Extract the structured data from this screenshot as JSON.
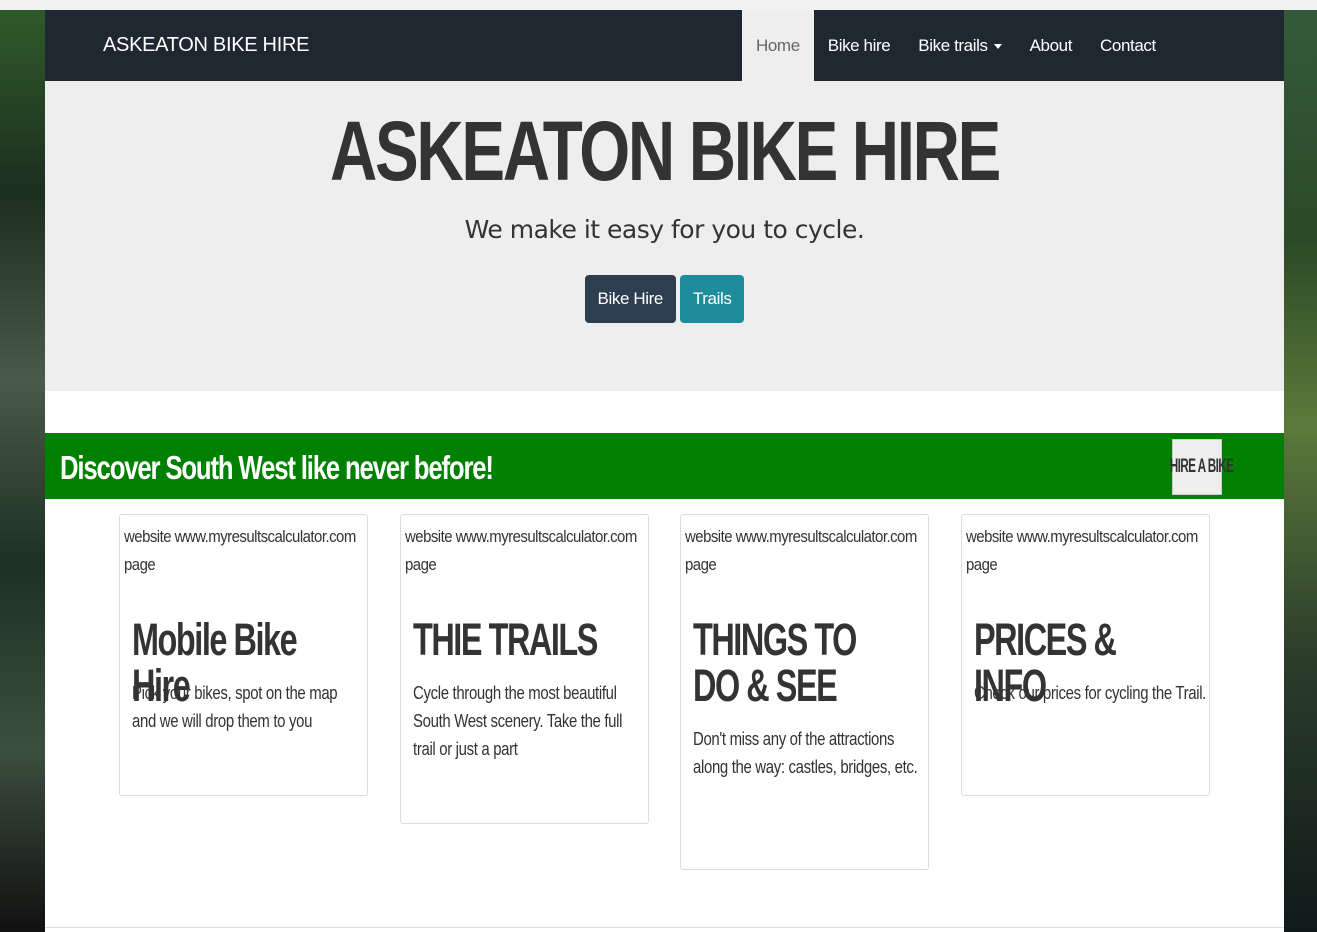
{
  "navbar": {
    "brand": "ASKEATON BIKE HIRE",
    "items": [
      {
        "label": "Home"
      },
      {
        "label": "Bike hire"
      },
      {
        "label": "Bike trails"
      },
      {
        "label": "About"
      },
      {
        "label": "Contact"
      }
    ]
  },
  "hero": {
    "title": "ASKEATON BIKE HIRE",
    "subtitle": "We make it easy for you to cycle.",
    "buttons": [
      {
        "label": "Bike Hire"
      },
      {
        "label": "Trails"
      }
    ]
  },
  "banner": {
    "text": "Discover South West like never before!",
    "button": "HIRE A BIKE"
  },
  "cards": [
    {
      "image_alt_line1": "website www.myresultscalculator.com",
      "image_alt_line2": "page",
      "title": "Mobile Bike Hire",
      "description": "Pick your bikes, spot on the map and we will drop them to you"
    },
    {
      "image_alt_line1": "website www.myresultscalculator.com",
      "image_alt_line2": "page",
      "title": "THIE TRAILS",
      "description": "Cycle through the most beautiful South West scenery. Take the full trail or just a part"
    },
    {
      "image_alt_line1": "website www.myresultscalculator.com",
      "image_alt_line2": "page",
      "title": "THINGS TO DO & SEE",
      "description": "Don't miss any of the attractions along the way: castles, bridges, etc."
    },
    {
      "image_alt_line1": "website www.myresultscalculator.com",
      "image_alt_line2": "page",
      "title": "PRICES & INFO",
      "description": "Check our prices for cycling the Trail."
    }
  ],
  "colors": {
    "navbar": "#1f2731",
    "banner": "#008000",
    "primary_button": "#2d3e50",
    "info_button": "#1f8c9d",
    "jumbotron": "#eeeeee"
  }
}
